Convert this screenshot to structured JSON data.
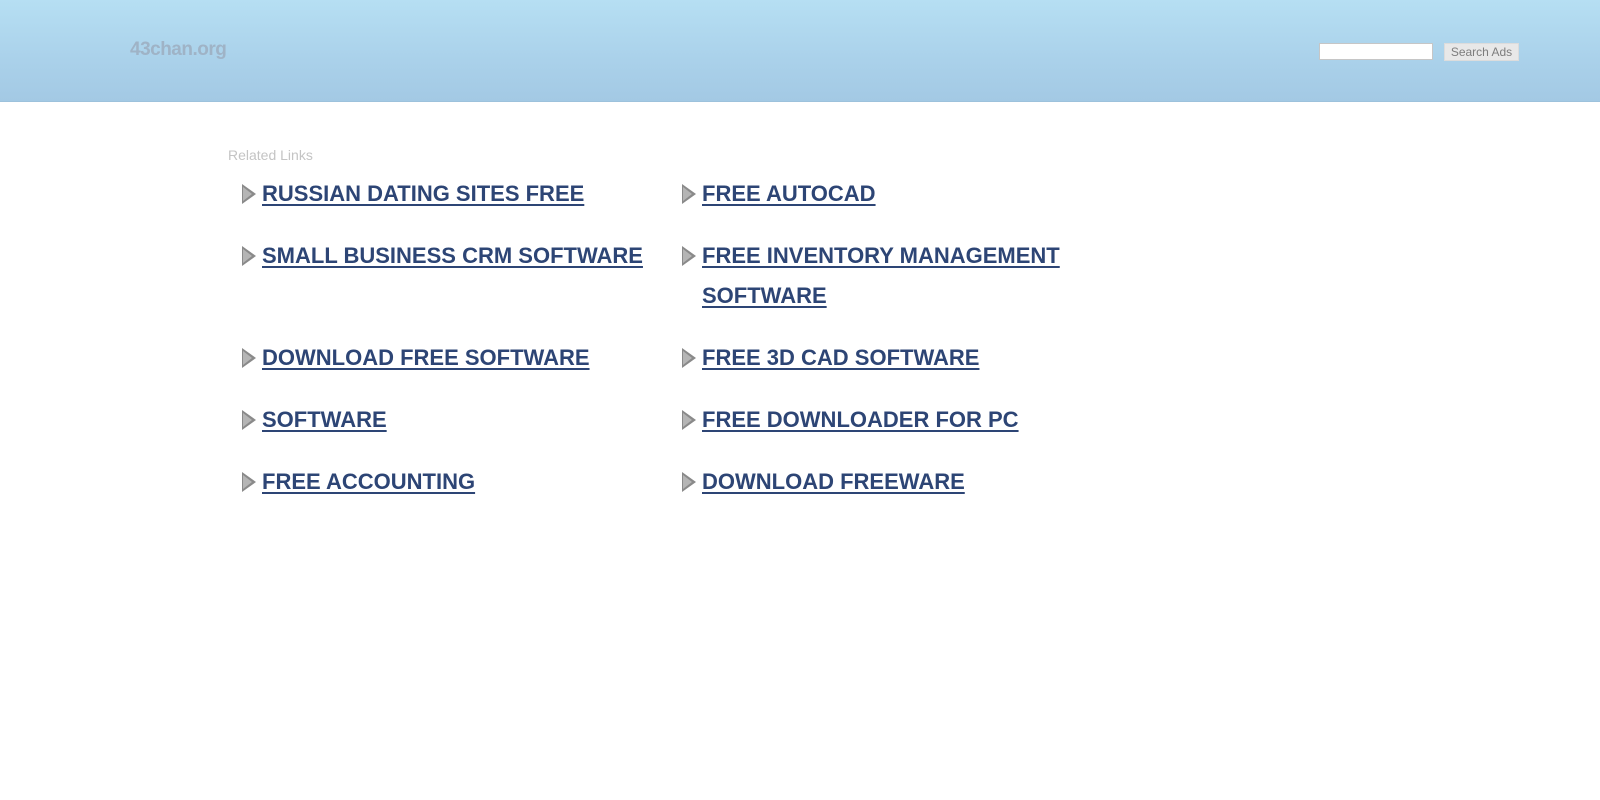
{
  "header": {
    "site_name": "43chan.org",
    "search_placeholder": "",
    "search_button_label": "Search Ads"
  },
  "main": {
    "related_title": "Related Links",
    "left_links": [
      "RUSSIAN DATING SITES FREE",
      "SMALL BUSINESS CRM SOFTWARE",
      "DOWNLOAD FREE SOFTWARE",
      "SOFTWARE",
      "FREE ACCOUNTING"
    ],
    "right_links": [
      "FREE AUTOCAD",
      "FREE INVENTORY MANAGEMENT SOFTWARE",
      "FREE 3D CAD SOFTWARE",
      "FREE DOWNLOADER FOR PC",
      "DOWNLOAD FREEWARE"
    ]
  },
  "colors": {
    "header_bg": "#b6dff3",
    "link": "#2d4575",
    "arrow": "#8a8a8a"
  },
  "icons": {
    "link_bullet": "triangle-arrow-icon"
  }
}
